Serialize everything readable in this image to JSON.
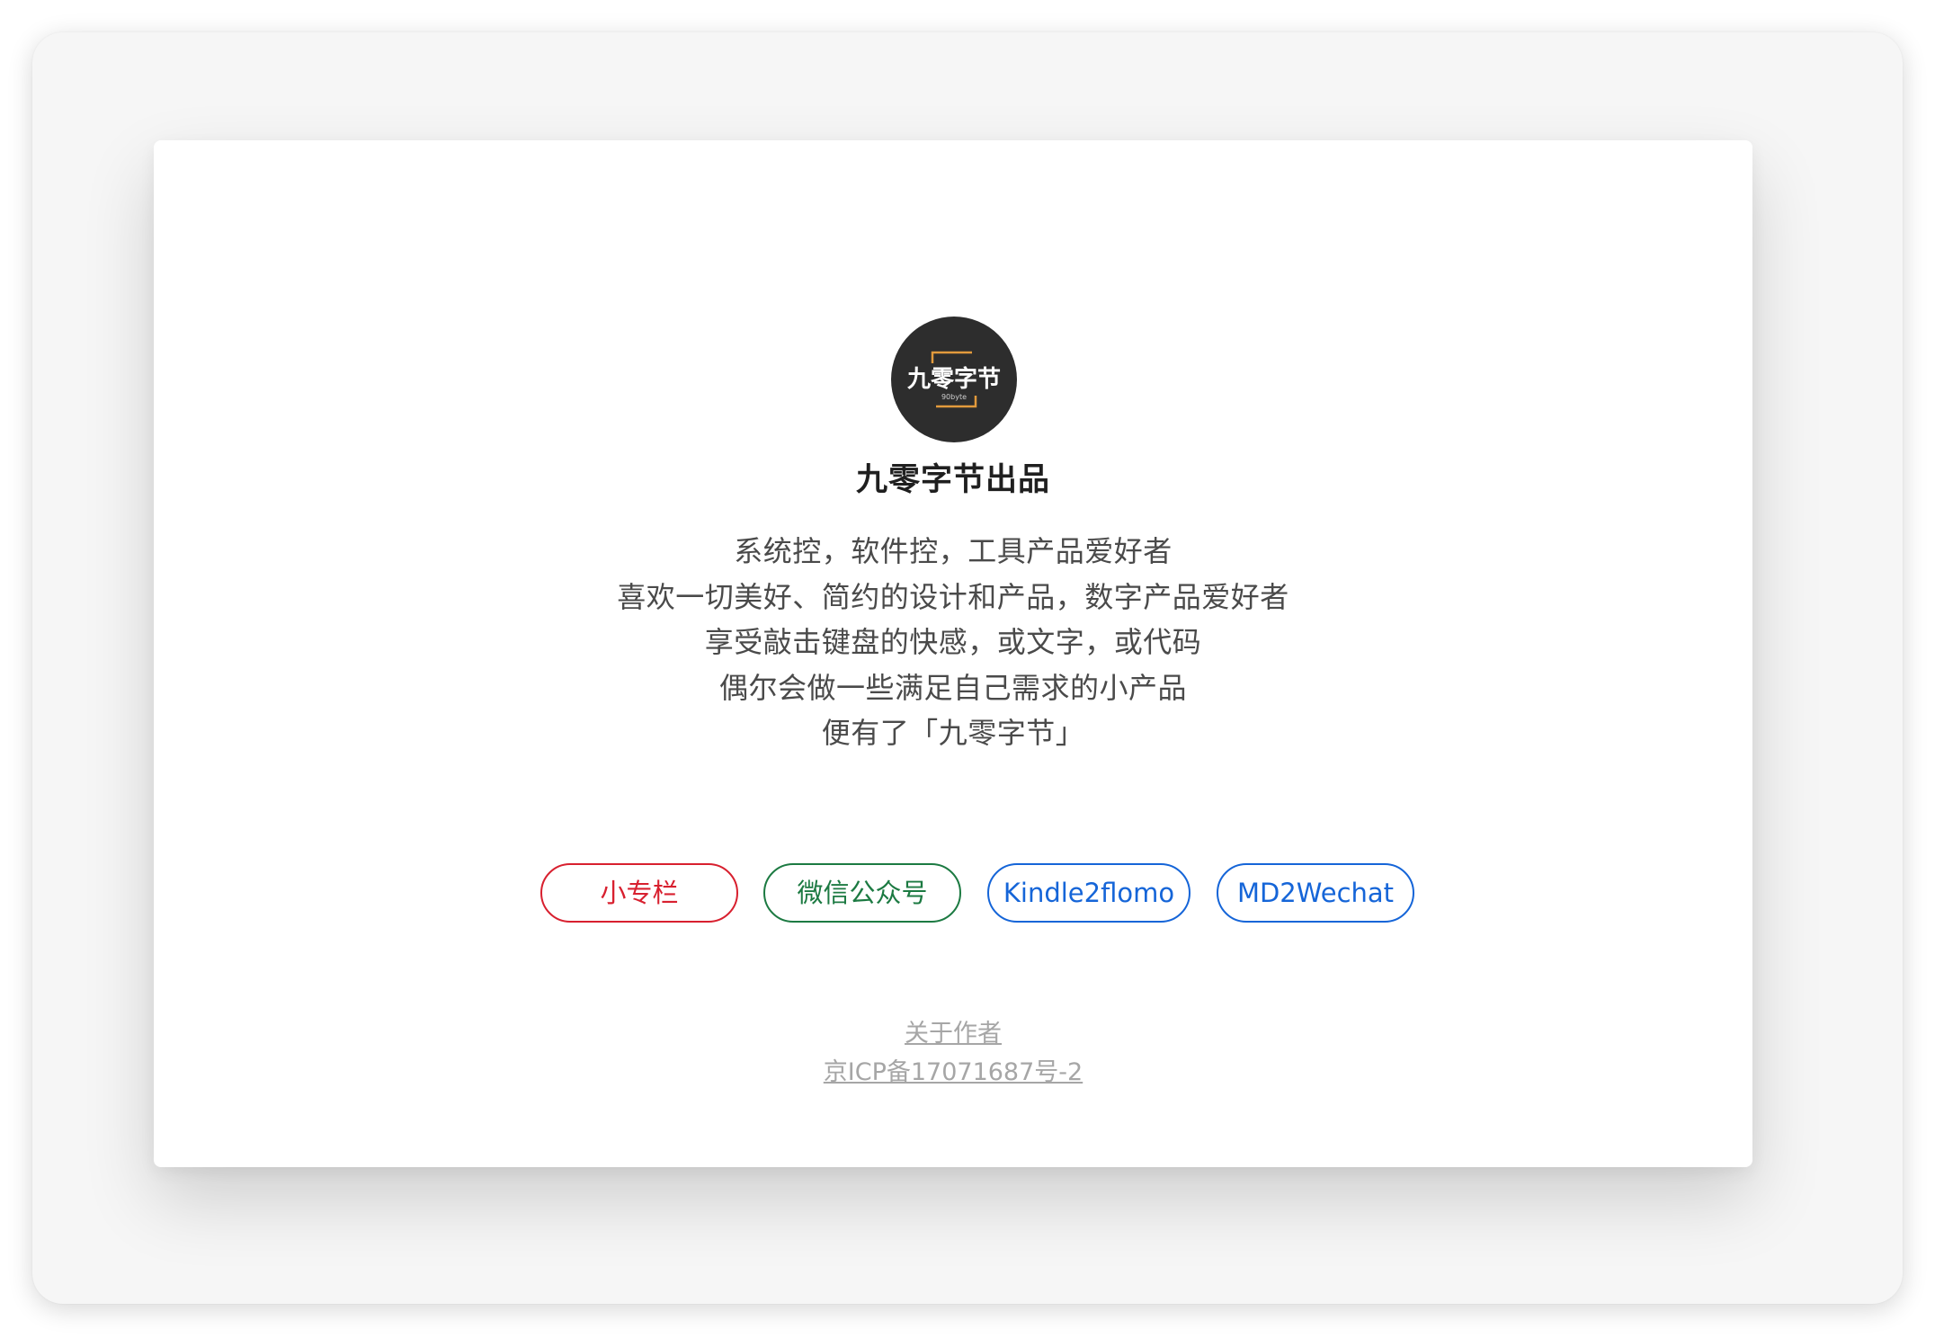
{
  "profile": {
    "avatar_text": "九零字节",
    "avatar_subtext": "90byte",
    "title": "九零字节出品"
  },
  "bio": {
    "lines": [
      "系统控，软件控，工具产品爱好者",
      "喜欢一切美好、简约的设计和产品，数字产品爱好者",
      "享受敲击键盘的快感，或文字，或代码",
      "偶尔会做一些满足自己需求的小产品",
      "便有了「九零字节」"
    ]
  },
  "links": [
    {
      "label": "小专栏",
      "color": "#d8202f"
    },
    {
      "label": "微信公众号",
      "color": "#1c7a42"
    },
    {
      "label": "Kindle2flomo",
      "color": "#1565d8"
    },
    {
      "label": "MD2Wechat",
      "color": "#1565d8"
    }
  ],
  "footer": {
    "about": "关于作者",
    "icp": "京ICP备17071687号-2"
  },
  "colors": {
    "window_bg": "#f6f6f6",
    "card_bg": "#ffffff",
    "avatar_bg": "#2d2d2d",
    "avatar_accent": "#e29a3c",
    "title": "#1f1f1f",
    "body_text": "#4a4a4a",
    "footer_link": "#a6a6a6"
  }
}
